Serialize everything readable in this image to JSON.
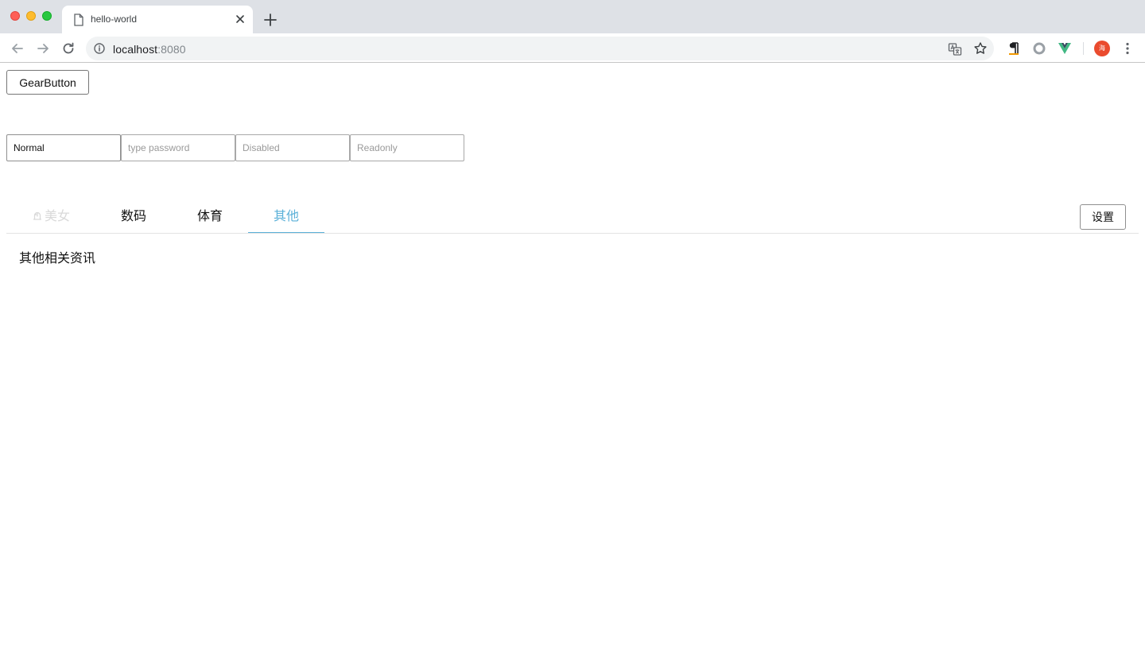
{
  "browser": {
    "tab_title": "hello-world",
    "url_host": "localhost",
    "url_port": ":8080",
    "profile_initial": "海"
  },
  "page": {
    "gear_button_label": "GearButton",
    "inputs": {
      "normal_value": "Normal",
      "password_placeholder": "type password",
      "disabled_placeholder": "Disabled",
      "readonly_placeholder": "Readonly"
    },
    "tabs": [
      {
        "label": "美女",
        "icon": "tab-ornament-icon",
        "state": "disabled"
      },
      {
        "label": "数码",
        "state": "normal"
      },
      {
        "label": "体育",
        "state": "normal"
      },
      {
        "label": "其他",
        "state": "active"
      }
    ],
    "settings_button_label": "设置",
    "tab_content_text": "其他相关资讯"
  },
  "colors": {
    "accent": "#5ab0d8",
    "disabled_text": "#d9d9d9",
    "profile": "#ea4b2e"
  }
}
